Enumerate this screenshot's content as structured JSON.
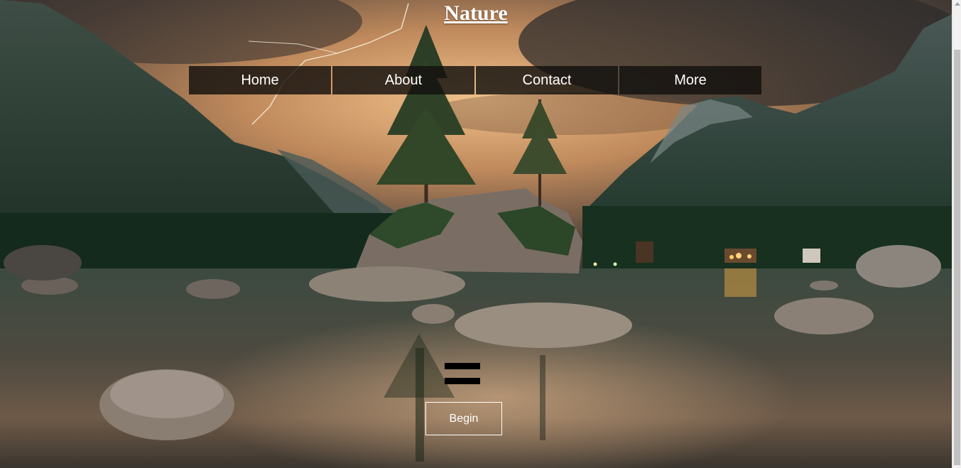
{
  "page": {
    "title": "Nature"
  },
  "nav": {
    "items": [
      {
        "label": "Home"
      },
      {
        "label": "About"
      },
      {
        "label": "Contact"
      },
      {
        "label": "More"
      }
    ]
  },
  "hero": {
    "menu_icon": "hamburger-menu-icon",
    "begin_label": "Begin"
  },
  "colors": {
    "nav_bg": "#12100e",
    "text": "#ffffff",
    "sky_glow": "#e8b27a",
    "mountain": "#1f3b2c"
  }
}
